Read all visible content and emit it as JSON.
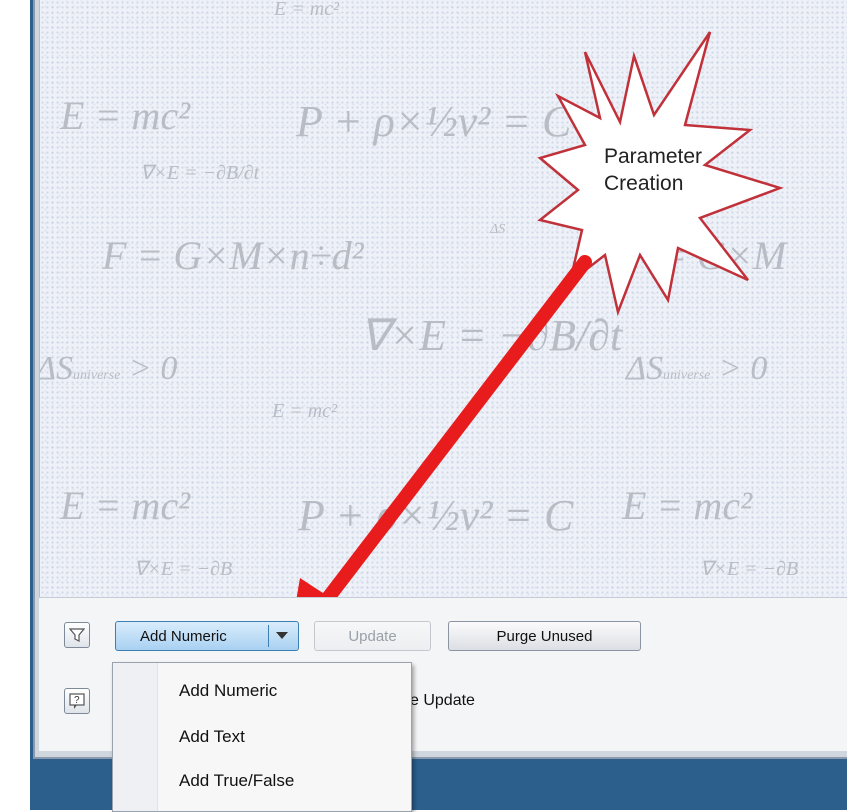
{
  "canvas": {
    "background_equations": [
      "E = mc²",
      "∇×E = −∂B/∂t",
      "P + ρ × ½v² = C",
      "F = G×M×n÷d²",
      "ΔS_universe > 0"
    ]
  },
  "callout": {
    "text_line1": "Parameter",
    "text_line2": "Creation",
    "fill_color": "#ffffff",
    "border_color": "#c0313a",
    "arrow_color": "#e81c1c"
  },
  "toolbar": {
    "add_split_label": "Add Numeric",
    "update_label": "Update",
    "purge_label": "Purge Unused",
    "partial_checkbox_label": "e Update"
  },
  "add_menu": {
    "items": [
      {
        "label": "Add Numeric"
      },
      {
        "label": "Add Text"
      },
      {
        "label": "Add True/False"
      }
    ]
  },
  "icons": {
    "filter": "filter-icon",
    "help": "help-icon",
    "dropdown": "dropdown-arrow-icon"
  }
}
